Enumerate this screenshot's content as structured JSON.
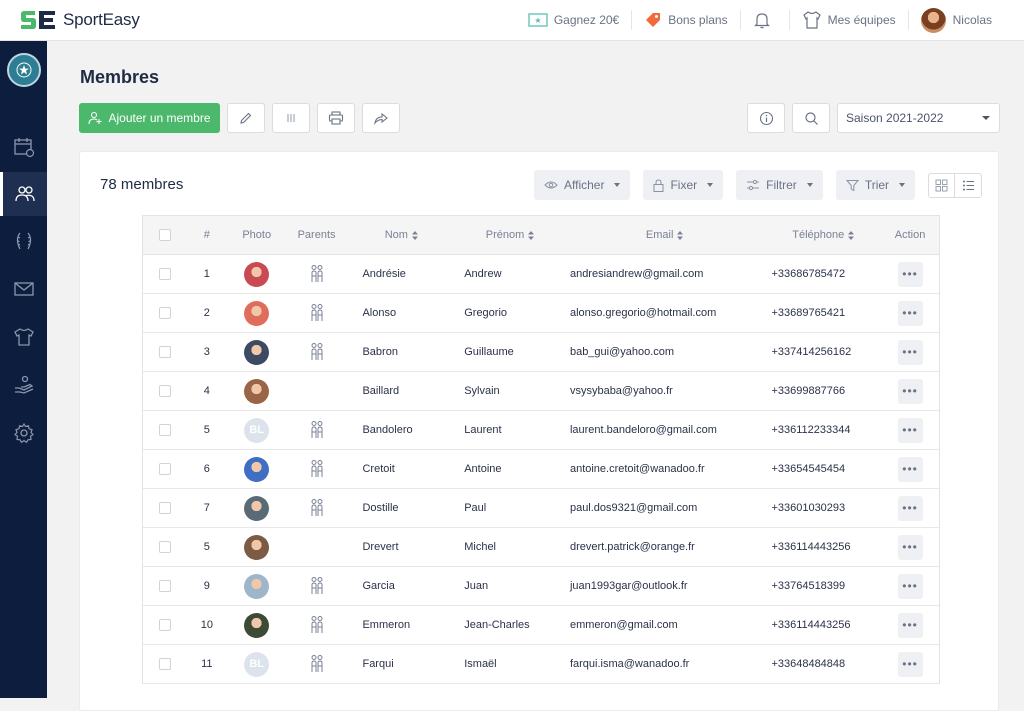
{
  "app": {
    "name": "SportEasy"
  },
  "topnav": {
    "earn": "Gagnez 20€",
    "deals": "Bons plans",
    "teams": "Mes équipes",
    "user": "Nicolas"
  },
  "page": {
    "title": "Membres",
    "add_member": "Ajouter un membre",
    "season": "Saison 2021-2022",
    "count": "78 membres"
  },
  "filters": {
    "show": "Afficher",
    "pin": "Fixer",
    "filter": "Filtrer",
    "sort": "Trier"
  },
  "table": {
    "headers": {
      "num": "#",
      "photo": "Photo",
      "parents": "Parents",
      "nom": "Nom",
      "prenom": "Prénom",
      "email": "Email",
      "tel": "Téléphone",
      "action": "Action"
    },
    "rows": [
      {
        "num": "1",
        "nom": "Andrésie",
        "prenom": "Andrew",
        "email": "andresiandrew@gmail.com",
        "tel": "+33686785472",
        "parents": true,
        "photo": "#c94a52"
      },
      {
        "num": "2",
        "nom": "Alonso",
        "prenom": "Gregorio",
        "email": "alonso.gregorio@hotmail.com",
        "tel": "+33689765421",
        "parents": true,
        "photo": "#e06c5c"
      },
      {
        "num": "3",
        "nom": "Babron",
        "prenom": "Guillaume",
        "email": "bab_gui@yahoo.com",
        "tel": "+337414256162",
        "parents": true,
        "photo": "#3c4a63"
      },
      {
        "num": "4",
        "nom": "Baillard",
        "prenom": "Sylvain",
        "email": "vsysybaba@yahoo.fr",
        "tel": "+33699887766",
        "parents": false,
        "photo": "#9a6547"
      },
      {
        "num": "5",
        "nom": "Bandolero",
        "prenom": "Laurent",
        "email": "laurent.bandeloro@gmail.com",
        "tel": "+336112233344",
        "parents": true,
        "initials": "BL"
      },
      {
        "num": "6",
        "nom": "Cretoit",
        "prenom": "Antoine",
        "email": "antoine.cretoit@wanadoo.fr",
        "tel": "+33654545454",
        "parents": true,
        "photo": "#3f6fc2"
      },
      {
        "num": "7",
        "nom": "Dostille",
        "prenom": "Paul",
        "email": "paul.dos9321@gmail.com",
        "tel": "+33601030293",
        "parents": true,
        "photo": "#5a6b78"
      },
      {
        "num": "5",
        "nom": "Drevert",
        "prenom": "Michel",
        "email": "drevert.patrick@orange.fr",
        "tel": "+336114443256",
        "parents": false,
        "photo": "#7d5a44"
      },
      {
        "num": "9",
        "nom": "Garcia",
        "prenom": "Juan",
        "email": "juan1993gar@outlook.fr",
        "tel": "+33764518399",
        "parents": true,
        "photo": "#9db6c9"
      },
      {
        "num": "10",
        "nom": "Emmeron",
        "prenom": "Jean-Charles",
        "email": "emmeron@gmail.com",
        "tel": "+336114443256",
        "parents": true,
        "photo": "#3d4a35"
      },
      {
        "num": "11",
        "nom": "Farqui",
        "prenom": "Ismaël",
        "email": "farqui.isma@wanadoo.fr",
        "tel": "+33648484848",
        "parents": true,
        "initials": "BL"
      }
    ]
  },
  "colors": {
    "primary": "#4cb86c",
    "sidebar": "#0d1d3d",
    "deal": "#f06a3c"
  }
}
